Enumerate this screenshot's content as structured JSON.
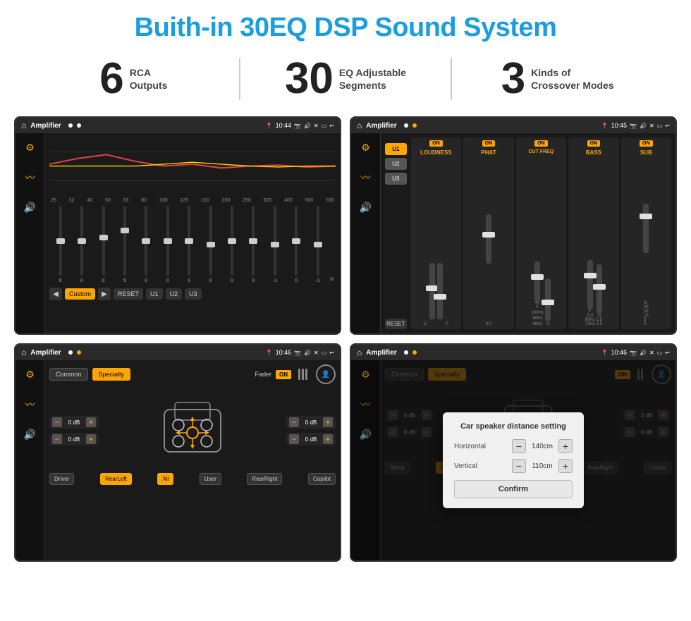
{
  "page": {
    "title": "Buith-in 30EQ DSP Sound System",
    "stats": [
      {
        "number": "6",
        "label": "RCA\nOutputs"
      },
      {
        "number": "30",
        "label": "EQ Adjustable\nSegments"
      },
      {
        "number": "3",
        "label": "Kinds of\nCrossover Modes"
      }
    ]
  },
  "screens": {
    "eq": {
      "title": "Amplifier",
      "time": "10:44",
      "freqs": [
        "25",
        "32",
        "40",
        "50",
        "63",
        "80",
        "100",
        "125",
        "160",
        "200",
        "250",
        "320",
        "400",
        "500",
        "630"
      ],
      "values": [
        "0",
        "0",
        "0",
        "5",
        "0",
        "0",
        "0",
        "0",
        "0",
        "0",
        "-1",
        "0",
        "-1"
      ],
      "buttons": [
        "Custom",
        "RESET",
        "U1",
        "U2",
        "U3"
      ]
    },
    "channel": {
      "title": "Amplifier",
      "time": "10:45",
      "presets": [
        "U1",
        "U2",
        "U3"
      ],
      "channels": [
        {
          "id": "LOUDNESS",
          "on": true
        },
        {
          "id": "PHAT",
          "on": true
        },
        {
          "id": "CUT FREQ",
          "on": true
        },
        {
          "id": "BASS",
          "on": true
        },
        {
          "id": "SUB",
          "on": true
        }
      ],
      "reset": "RESET"
    },
    "fader": {
      "title": "Amplifier",
      "time": "10:46",
      "modes": [
        "Common",
        "Specialty"
      ],
      "faderLabel": "Fader",
      "onLabel": "ON",
      "volumes": [
        {
          "label": "0 dB"
        },
        {
          "label": "0 dB"
        },
        {
          "label": "0 dB"
        },
        {
          "label": "0 dB"
        }
      ],
      "positions": [
        "Driver",
        "RearLeft",
        "All",
        "User",
        "RearRight",
        "Copilot"
      ]
    },
    "dialog": {
      "title": "Amplifier",
      "time": "10:46",
      "modes": [
        "Common",
        "Specialty"
      ],
      "onLabel": "ON",
      "dialogTitle": "Car speaker distance setting",
      "fields": [
        {
          "label": "Horizontal",
          "value": "140cm"
        },
        {
          "label": "Vertical",
          "value": "110cm"
        }
      ],
      "confirmLabel": "Confirm",
      "sideVolumes": [
        {
          "label": "0 dB"
        },
        {
          "label": "0 dB"
        }
      ],
      "positions": [
        "Driver",
        "RearLeft",
        "All",
        "User",
        "RearRight",
        "Copilot"
      ]
    }
  }
}
